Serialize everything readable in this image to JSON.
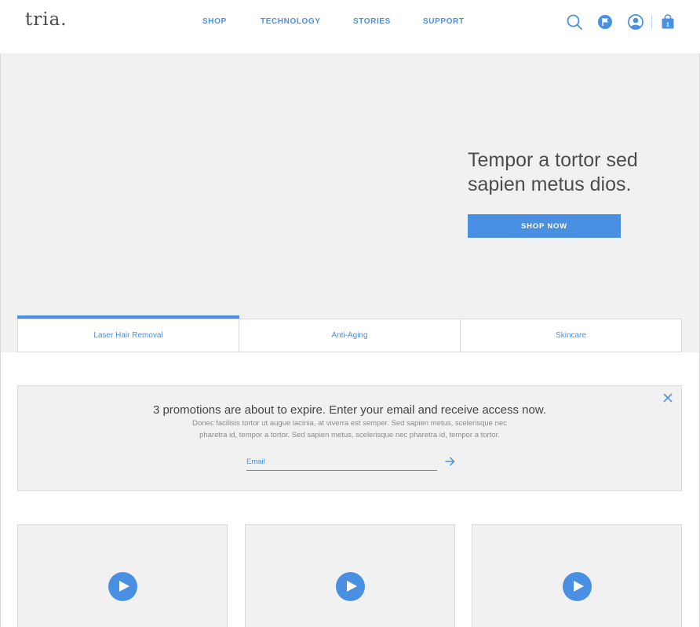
{
  "header": {
    "logo": "tria.",
    "nav": [
      "SHOP",
      "TECHNOLOGY",
      "STORIES",
      "SUPPORT"
    ],
    "icons": [
      "search-icon",
      "flag-icon",
      "account-icon",
      "shopping-bag-icon"
    ],
    "cart_count": "1"
  },
  "hero": {
    "headline": "Tempor a tortor sed sapien metus dios.",
    "cta_label": "SHOP NOW"
  },
  "tabs": [
    {
      "label": "Laser Hair Removal",
      "active": true
    },
    {
      "label": "Anti-Aging",
      "active": false
    },
    {
      "label": "Skincare",
      "active": false
    }
  ],
  "promo": {
    "title": "3 promotions are about to expire. Enter your email and receive access now.",
    "body_line1": "Donec facilisis tortor ut augue lacinia, at viverra est semper. Sed sapien metus, scelerisque nec",
    "body_line2": "pharetra id, tempor a tortor. Sed sapien metus, scelerisque nec pharetra id, tempor a tortor.",
    "email_placeholder": "Email",
    "email_value": ""
  },
  "videos": [
    {
      "icon": "play-icon"
    },
    {
      "icon": "play-icon"
    },
    {
      "icon": "play-icon"
    }
  ],
  "colors": {
    "accent": "#4a90e2",
    "panel": "#f1f1f1",
    "border": "#d9d9d9"
  }
}
